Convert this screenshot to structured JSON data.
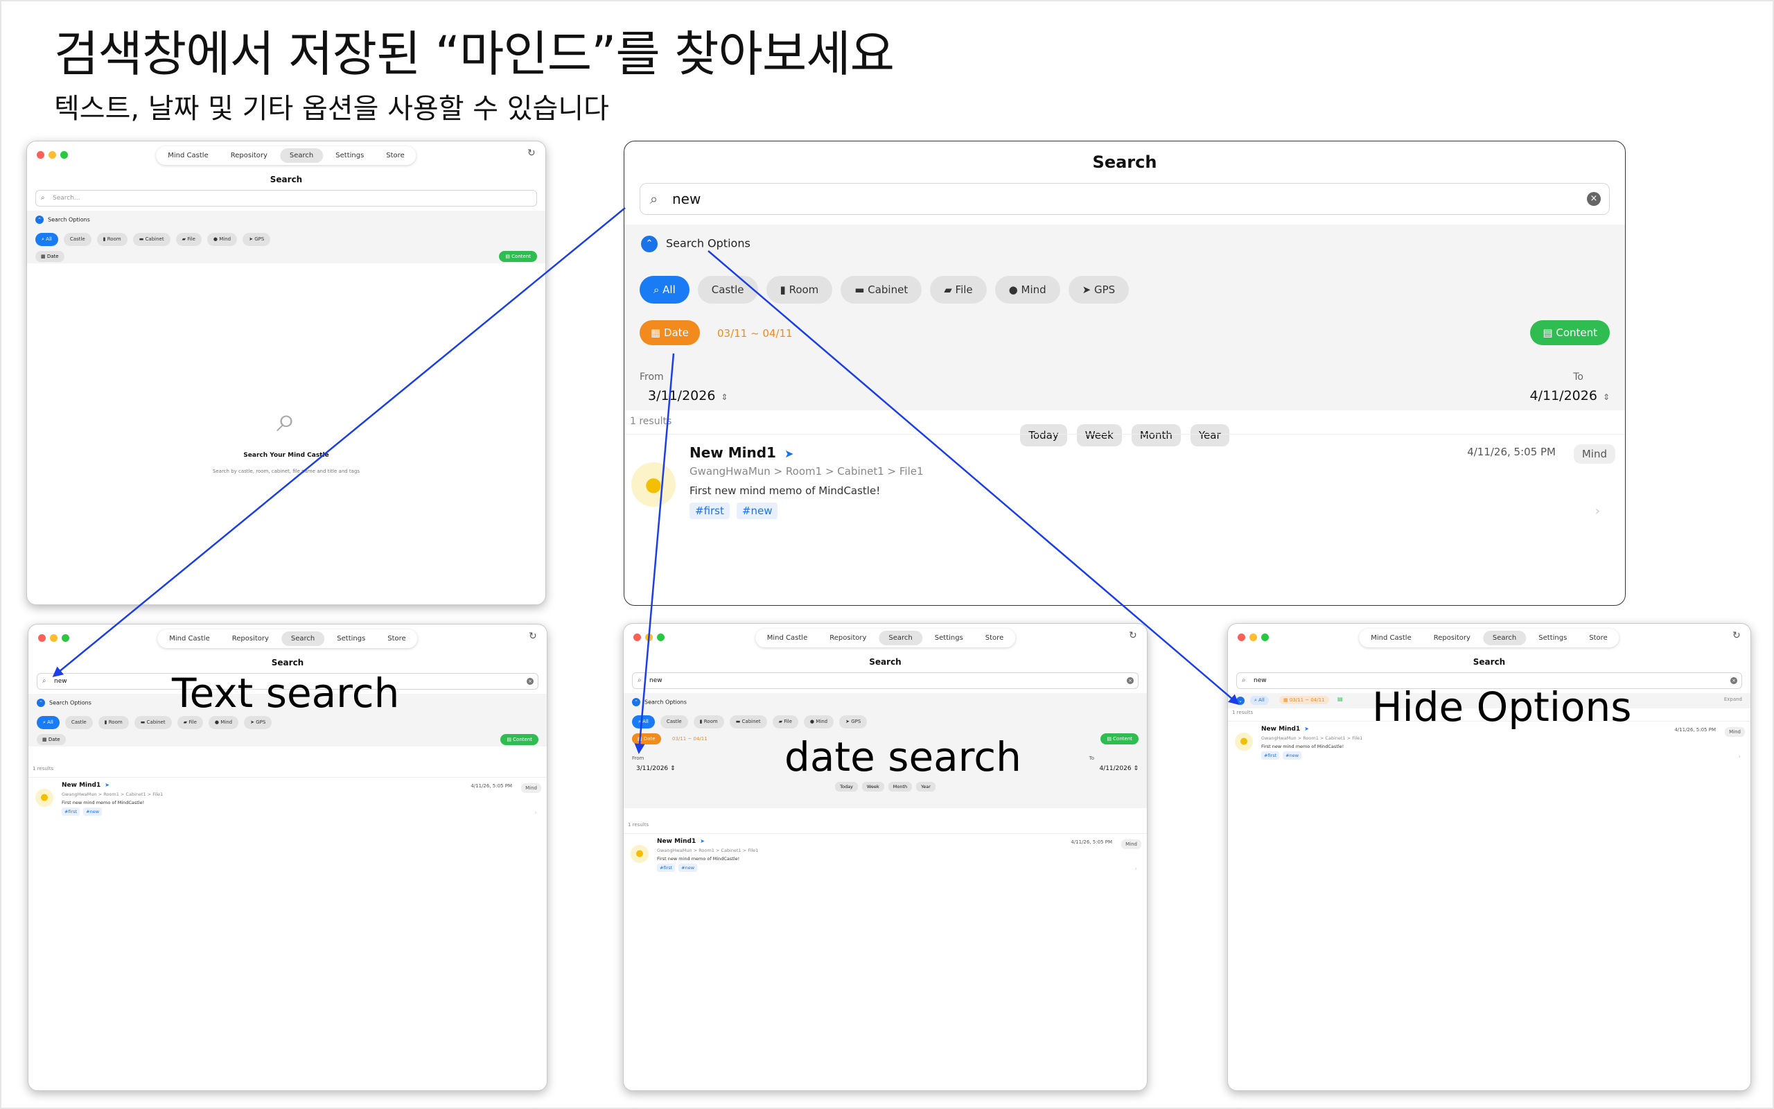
{
  "heading": "검색창에서 저장된 “마인드”를 찾아보세요",
  "subheading": "텍스트, 날짜 및 기타 옵션을 사용할 수 있습니다",
  "tabs": [
    "Mind Castle",
    "Repository",
    "Search",
    "Settings",
    "Store"
  ],
  "search": {
    "title": "Search",
    "placeholder": "Search...",
    "query": "new",
    "options_label": "Search Options",
    "chips": [
      "All",
      "Castle",
      "Room",
      "Cabinet",
      "File",
      "Mind",
      "GPS"
    ],
    "date_label": "Date",
    "date_range": "03/11 ~ 04/11",
    "content_label": "Content",
    "from_label": "From",
    "to_label": "To",
    "from_value": "3/11/2026",
    "to_value": "4/11/2026",
    "quick_ranges": [
      "Today",
      "Week",
      "Month",
      "Year"
    ],
    "expand_label": "Expand"
  },
  "empty": {
    "title": "Search Your Mind Castle",
    "subtitle": "Search by castle, room, cabinet, file name and title and tags"
  },
  "results": {
    "count_label": "1 results",
    "item": {
      "name": "New Mind1",
      "path": "GwangHwaMun > Room1 > Cabinet1 > File1",
      "description": "First new mind memo of MindCastle!",
      "tags": [
        "#first",
        "#new"
      ],
      "time": "4/11/26, 5:05 PM",
      "kind": "Mind"
    }
  },
  "labels": {
    "text_search": "Text search",
    "date_search": "date search",
    "hide_options": "Hide Options"
  },
  "colors": {
    "accent_blue": "#1a7cf5",
    "date_orange": "#f28a1d",
    "content_green": "#2fbd51",
    "arrow": "#1a3ee8"
  },
  "icons": [
    "search-icon",
    "clear-icon",
    "chevron-up-icon",
    "chevron-down-icon",
    "refresh-icon",
    "lightbulb-icon",
    "navigation-arrow-icon",
    "calendar-icon",
    "document-icon",
    "chevron-right-icon"
  ]
}
